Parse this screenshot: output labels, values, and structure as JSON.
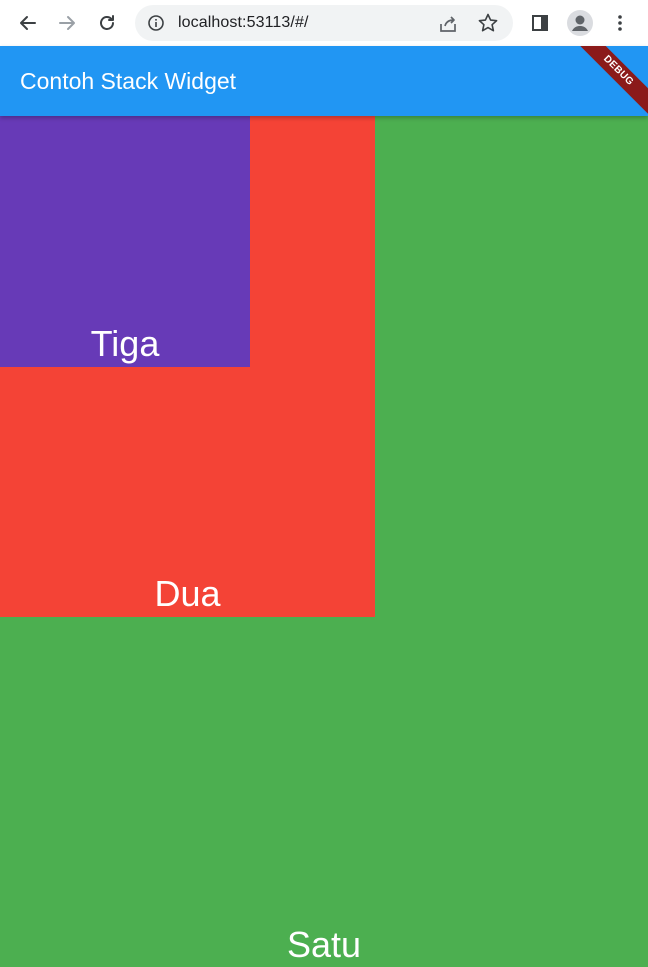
{
  "browser": {
    "url": "localhost:53113/#/",
    "icons": [
      "back-arrow-icon",
      "forward-arrow-icon",
      "reload-icon",
      "info-icon",
      "share-icon",
      "star-icon",
      "side-panel-icon",
      "profile-icon",
      "more-vert-icon"
    ]
  },
  "app_bar": {
    "title": "Contoh Stack Widget",
    "debug_label": "DEBUG",
    "color": "#2196f3"
  },
  "stack": {
    "boxes": [
      {
        "label": "Satu",
        "color": "#4caf50"
      },
      {
        "label": "Dua",
        "color": "#f44336"
      },
      {
        "label": "Tiga",
        "color": "#673ab7"
      }
    ]
  }
}
